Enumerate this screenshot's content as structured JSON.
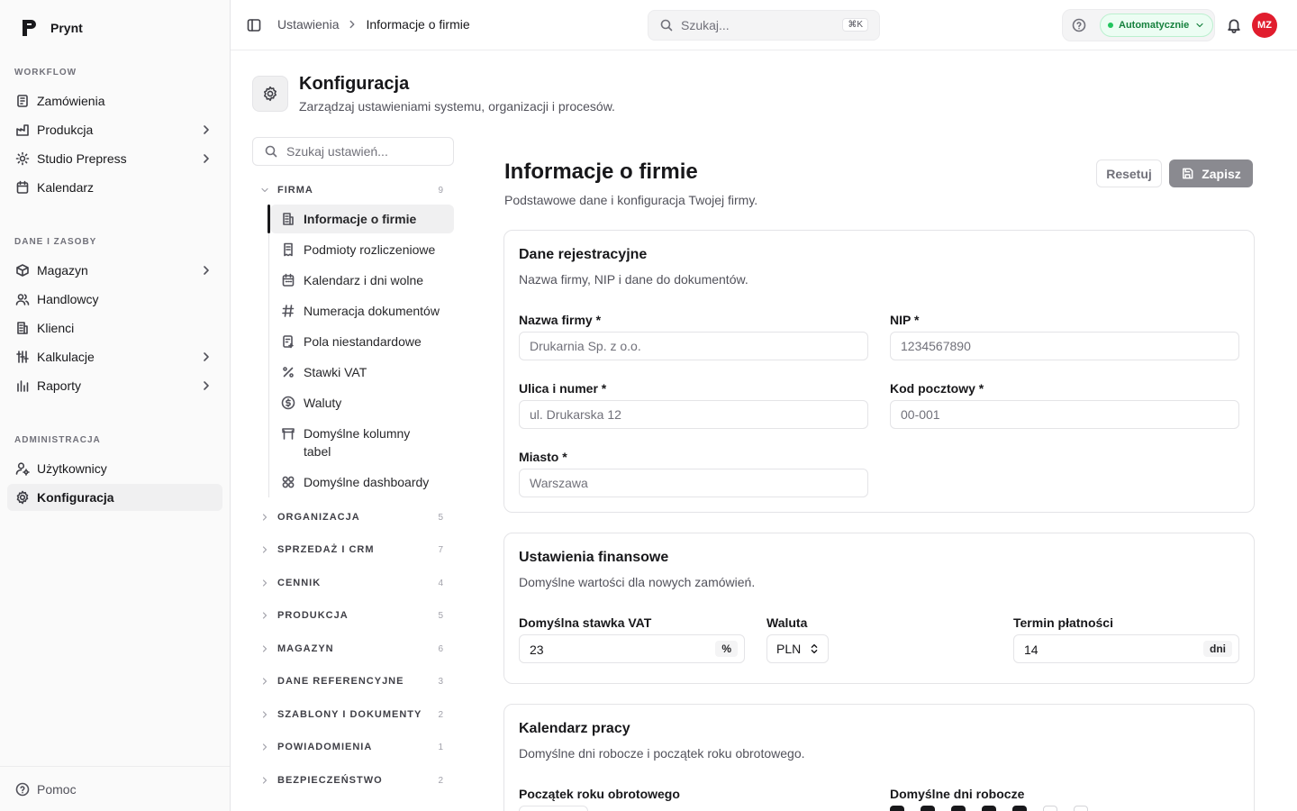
{
  "app": {
    "name": "Prynt"
  },
  "sidebar": {
    "sections": [
      {
        "label": "WORKFLOW"
      },
      {
        "label": "DANE I ZASOBY"
      },
      {
        "label": "ADMINISTRACJA"
      }
    ],
    "items": [
      {
        "label": "Zamówienia",
        "icon": "orders-icon"
      },
      {
        "label": "Produkcja",
        "icon": "factory-icon"
      },
      {
        "label": "Studio Prepress",
        "icon": "sun-icon"
      },
      {
        "label": "Kalendarz",
        "icon": "calendar-icon"
      },
      {
        "label": "Magazyn",
        "icon": "box-icon"
      },
      {
        "label": "Handlowcy",
        "icon": "users-icon"
      },
      {
        "label": "Klienci",
        "icon": "building-icon"
      },
      {
        "label": "Kalkulacje",
        "icon": "sliders-icon"
      },
      {
        "label": "Raporty",
        "icon": "chart-icon"
      },
      {
        "label": "Użytkownicy",
        "icon": "user-cog-icon"
      },
      {
        "label": "Konfiguracja",
        "icon": "gear-icon"
      }
    ],
    "footer": "Pomoc"
  },
  "topbar": {
    "breadcrumb": [
      "Ustawienia",
      "Informacje o firmie"
    ],
    "search_placeholder": "Szukaj...",
    "search_shortcut": "⌘K",
    "mode": "Automatycznie",
    "avatar": "MZ"
  },
  "page": {
    "title": "Konfiguracja",
    "subtitle": "Zarządzaj ustawieniami systemu, organizacji i procesów."
  },
  "settings_nav": {
    "search_placeholder": "Szukaj ustawień...",
    "groups": [
      {
        "label": "FIRMA",
        "count": "9"
      },
      {
        "label": "ORGANIZACJA",
        "count": "5"
      },
      {
        "label": "SPRZEDAŻ I CRM",
        "count": "7"
      },
      {
        "label": "CENNIK",
        "count": "4"
      },
      {
        "label": "PRODUKCJA",
        "count": "5"
      },
      {
        "label": "MAGAZYN",
        "count": "6"
      },
      {
        "label": "DANE REFERENCYJNE",
        "count": "3"
      },
      {
        "label": "SZABLONY I DOKUMENTY",
        "count": "2"
      },
      {
        "label": "POWIADOMIENIA",
        "count": "1"
      },
      {
        "label": "BEZPIECZEŃSTWO",
        "count": "2"
      }
    ],
    "firma_items": [
      {
        "label": "Informacje o firmie"
      },
      {
        "label": "Podmioty rozliczeniowe"
      },
      {
        "label": "Kalendarz i dni wolne"
      },
      {
        "label": "Numeracja dokumentów"
      },
      {
        "label": "Pola niestandardowe"
      },
      {
        "label": "Stawki VAT"
      },
      {
        "label": "Waluty"
      },
      {
        "label": "Domyślne kolumny tabel"
      },
      {
        "label": "Domyślne dashboardy"
      }
    ]
  },
  "content": {
    "title": "Informacje o firmie",
    "subtitle": "Podstawowe dane i konfiguracja Twojej firmy.",
    "reset_label": "Resetuj",
    "save_label": "Zapisz",
    "card1": {
      "title": "Dane rejestracyjne",
      "subtitle": "Nazwa firmy, NIP i dane do dokumentów.",
      "company_name_label": "Nazwa firmy *",
      "company_name_placeholder": "Drukarnia Sp. z o.o.",
      "nip_label": "NIP *",
      "nip_placeholder": "1234567890",
      "street_label": "Ulica i numer *",
      "street_placeholder": "ul. Drukarska 12",
      "postal_label": "Kod pocztowy *",
      "postal_placeholder": "00-001",
      "city_label": "Miasto *",
      "city_placeholder": "Warszawa"
    },
    "card2": {
      "title": "Ustawienia finansowe",
      "subtitle": "Domyślne wartości dla nowych zamówień.",
      "vat_label": "Domyślna stawka VAT",
      "vat_value": "23",
      "vat_suffix": "%",
      "currency_label": "Waluta",
      "currency_value": "PLN",
      "term_label": "Termin płatności",
      "term_value": "14",
      "term_suffix": "dni"
    },
    "card3": {
      "title": "Kalendarz pracy",
      "subtitle": "Domyślne dni robocze i początek roku obrotowego.",
      "fiscal_label": "Początek roku obrotowego",
      "workdays_label": "Domyślne dni robocze"
    }
  }
}
